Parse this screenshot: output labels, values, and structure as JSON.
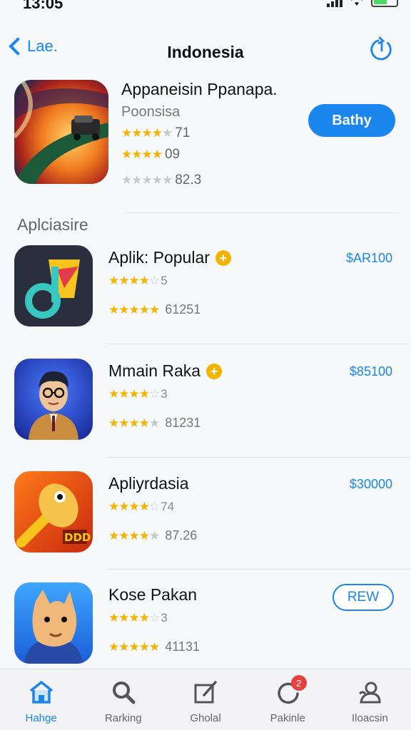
{
  "status": {
    "time": "13:05"
  },
  "nav": {
    "back_label": "Lae.",
    "title": "Indonesia"
  },
  "featured": {
    "title": "Appanеisin Ppanapa.",
    "subtitle": "Poonsisa",
    "rating1": "71",
    "rating2": "09",
    "rating3": "82.3",
    "button": "Bathy"
  },
  "section": {
    "label": "Aplciasire"
  },
  "apps": [
    {
      "name": "Aplik: Popular",
      "price": "$AR100",
      "r1": "5",
      "r2": "61251",
      "stars1": 4,
      "stars2": 5
    },
    {
      "name": "Mmain Raka",
      "price": "$85100",
      "r1": "3",
      "r2": "81231",
      "stars1": 4,
      "stars2": 4.5
    },
    {
      "name": "Apliyrdasia",
      "price": "$30000",
      "r1": "74",
      "r2": "87.26",
      "stars1": 4,
      "stars2": 4.5
    },
    {
      "name": "Kose Pakan",
      "button": "REW",
      "r1": "3",
      "r2": "41131",
      "stars1": 4,
      "stars2": 5
    }
  ],
  "tabs": [
    {
      "label": "Hahge",
      "icon": "home-icon",
      "active": true
    },
    {
      "label": "Rarking",
      "icon": "search-icon"
    },
    {
      "label": "Gholal",
      "icon": "compose-icon"
    },
    {
      "label": "Pakinle",
      "icon": "activity-icon",
      "badge": "2"
    },
    {
      "label": "Iloacsin",
      "icon": "profile-icon"
    }
  ],
  "colors": {
    "accent": "#1a86ee",
    "star": "#f5b301",
    "badge_red": "#e8403c"
  }
}
